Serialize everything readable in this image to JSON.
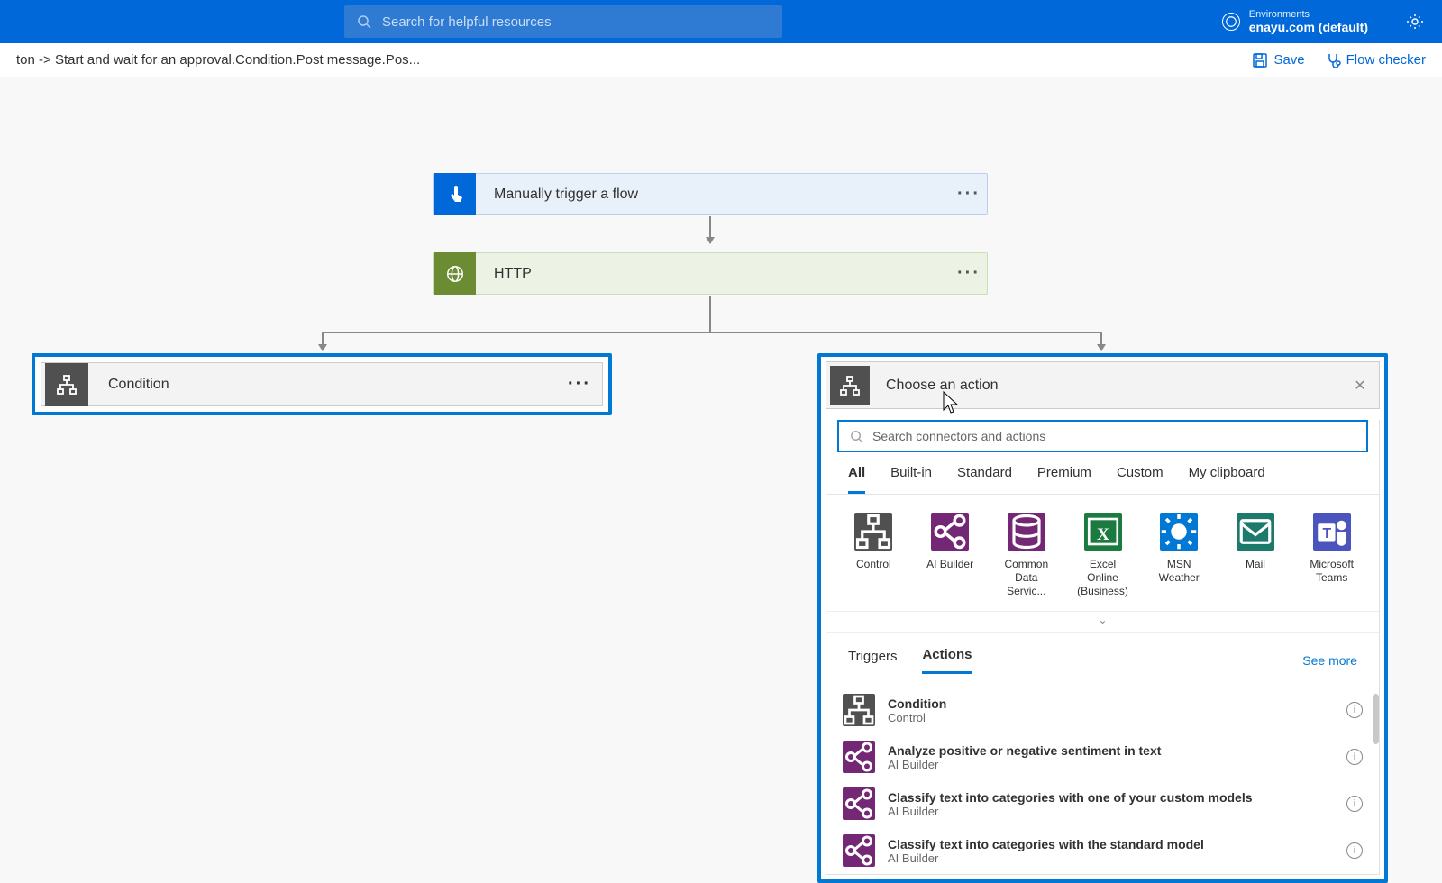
{
  "header": {
    "search_placeholder": "Search for helpful resources",
    "env_label": "Environments",
    "env_value": "enayu.com (default)"
  },
  "cmdbar": {
    "breadcrumb": "ton -> Start and wait for an approval.Condition.Post message.Pos...",
    "save": "Save",
    "flowchecker": "Flow checker"
  },
  "flow": {
    "trigger": "Manually trigger a flow",
    "http": "HTTP",
    "condition": "Condition"
  },
  "panel": {
    "title": "Choose an action",
    "search_placeholder": "Search connectors and actions",
    "tabs": [
      "All",
      "Built-in",
      "Standard",
      "Premium",
      "Custom",
      "My clipboard"
    ],
    "connectors": [
      {
        "label": "Control",
        "color": "#505050",
        "icon": "control"
      },
      {
        "label": "AI Builder",
        "color": "#742774",
        "icon": "share"
      },
      {
        "label": "Common Data Servic...",
        "color": "#742774",
        "icon": "db"
      },
      {
        "label": "Excel Online (Business)",
        "color": "#1b7a3f",
        "icon": "xl"
      },
      {
        "label": "MSN Weather",
        "color": "#0078d4",
        "icon": "sun"
      },
      {
        "label": "Mail",
        "color": "#1b7a6b",
        "icon": "mail"
      },
      {
        "label": "Microsoft Teams",
        "color": "#4b53bc",
        "icon": "teams"
      }
    ],
    "subtabs": {
      "triggers": "Triggers",
      "actions": "Actions",
      "seemore": "See more"
    },
    "actions": [
      {
        "title": "Condition",
        "sub": "Control",
        "color": "#505050",
        "icon": "control"
      },
      {
        "title": "Analyze positive or negative sentiment in text",
        "sub": "AI Builder",
        "color": "#742774",
        "icon": "share"
      },
      {
        "title": "Classify text into categories with one of your custom models",
        "sub": "AI Builder",
        "color": "#742774",
        "icon": "share"
      },
      {
        "title": "Classify text into categories with the standard model",
        "sub": "AI Builder",
        "color": "#742774",
        "icon": "share"
      }
    ]
  }
}
